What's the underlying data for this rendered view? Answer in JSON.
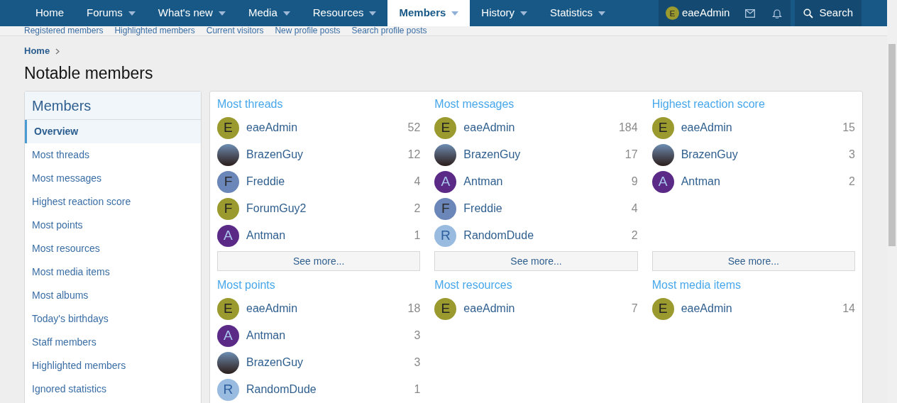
{
  "nav": {
    "tabs": [
      {
        "label": "Home",
        "dropdown": false,
        "selected": false
      },
      {
        "label": "Forums",
        "dropdown": true,
        "selected": false
      },
      {
        "label": "What's new",
        "dropdown": true,
        "selected": false
      },
      {
        "label": "Media",
        "dropdown": true,
        "selected": false
      },
      {
        "label": "Resources",
        "dropdown": true,
        "selected": false
      },
      {
        "label": "Members",
        "dropdown": true,
        "selected": true
      },
      {
        "label": "History",
        "dropdown": true,
        "selected": false
      },
      {
        "label": "Statistics",
        "dropdown": true,
        "selected": false
      }
    ],
    "user": {
      "initial": "E",
      "name": "eaeAdmin",
      "color": "#9a9a2e"
    },
    "search": "Search"
  },
  "subnav": [
    "Registered members",
    "Highlighted members",
    "Current visitors",
    "New profile posts",
    "Search profile posts"
  ],
  "breadcrumb": [
    "Home"
  ],
  "title": "Notable members",
  "sidebar": {
    "title": "Members",
    "items": [
      {
        "label": "Overview",
        "selected": true
      },
      {
        "label": "Most threads",
        "selected": false
      },
      {
        "label": "Most messages",
        "selected": false
      },
      {
        "label": "Highest reaction score",
        "selected": false
      },
      {
        "label": "Most points",
        "selected": false
      },
      {
        "label": "Most resources",
        "selected": false
      },
      {
        "label": "Most media items",
        "selected": false
      },
      {
        "label": "Most albums",
        "selected": false
      },
      {
        "label": "Today's birthdays",
        "selected": false
      },
      {
        "label": "Staff members",
        "selected": false
      },
      {
        "label": "Highlighted members",
        "selected": false
      },
      {
        "label": "Ignored statistics",
        "selected": false
      }
    ]
  },
  "sections": [
    {
      "title": "Most threads",
      "see_more": "See more...",
      "members": [
        {
          "kind": "letter",
          "initial": "E",
          "color": "#9a9a2e",
          "name": "eaeAdmin",
          "count": "52"
        },
        {
          "kind": "photo",
          "name": "BrazenGuy",
          "count": "12"
        },
        {
          "kind": "letter",
          "initial": "F",
          "color": "#6b86b8",
          "name": "Freddie",
          "count": "4"
        },
        {
          "kind": "letter",
          "initial": "F",
          "color": "#9a9a2e",
          "name": "ForumGuy2",
          "count": "2"
        },
        {
          "kind": "letter",
          "initial": "A",
          "color": "#5b2a86",
          "name": "Antman",
          "count": "1"
        }
      ]
    },
    {
      "title": "Most messages",
      "see_more": "See more...",
      "members": [
        {
          "kind": "letter",
          "initial": "E",
          "color": "#9a9a2e",
          "name": "eaeAdmin",
          "count": "184"
        },
        {
          "kind": "photo",
          "name": "BrazenGuy",
          "count": "17"
        },
        {
          "kind": "letter",
          "initial": "A",
          "color": "#5b2a86",
          "name": "Antman",
          "count": "9"
        },
        {
          "kind": "letter",
          "initial": "F",
          "color": "#6b86b8",
          "name": "Freddie",
          "count": "4"
        },
        {
          "kind": "letter",
          "initial": "R",
          "color": "#99bbe0",
          "name": "RandomDude",
          "count": "2"
        }
      ]
    },
    {
      "title": "Highest reaction score",
      "see_more": "See more...",
      "members": [
        {
          "kind": "letter",
          "initial": "E",
          "color": "#9a9a2e",
          "name": "eaeAdmin",
          "count": "15"
        },
        {
          "kind": "photo",
          "name": "BrazenGuy",
          "count": "3"
        },
        {
          "kind": "letter",
          "initial": "A",
          "color": "#5b2a86",
          "name": "Antman",
          "count": "2"
        }
      ]
    },
    {
      "title": "Most points",
      "members": [
        {
          "kind": "letter",
          "initial": "E",
          "color": "#9a9a2e",
          "name": "eaeAdmin",
          "count": "18"
        },
        {
          "kind": "letter",
          "initial": "A",
          "color": "#5b2a86",
          "name": "Antman",
          "count": "3"
        },
        {
          "kind": "photo",
          "name": "BrazenGuy",
          "count": "3"
        },
        {
          "kind": "letter",
          "initial": "R",
          "color": "#99bbe0",
          "name": "RandomDude",
          "count": "1"
        }
      ]
    },
    {
      "title": "Most resources",
      "members": [
        {
          "kind": "letter",
          "initial": "E",
          "color": "#9a9a2e",
          "name": "eaeAdmin",
          "count": "7"
        }
      ]
    },
    {
      "title": "Most media items",
      "members": [
        {
          "kind": "letter",
          "initial": "E",
          "color": "#9a9a2e",
          "name": "eaeAdmin",
          "count": "14"
        }
      ]
    }
  ]
}
